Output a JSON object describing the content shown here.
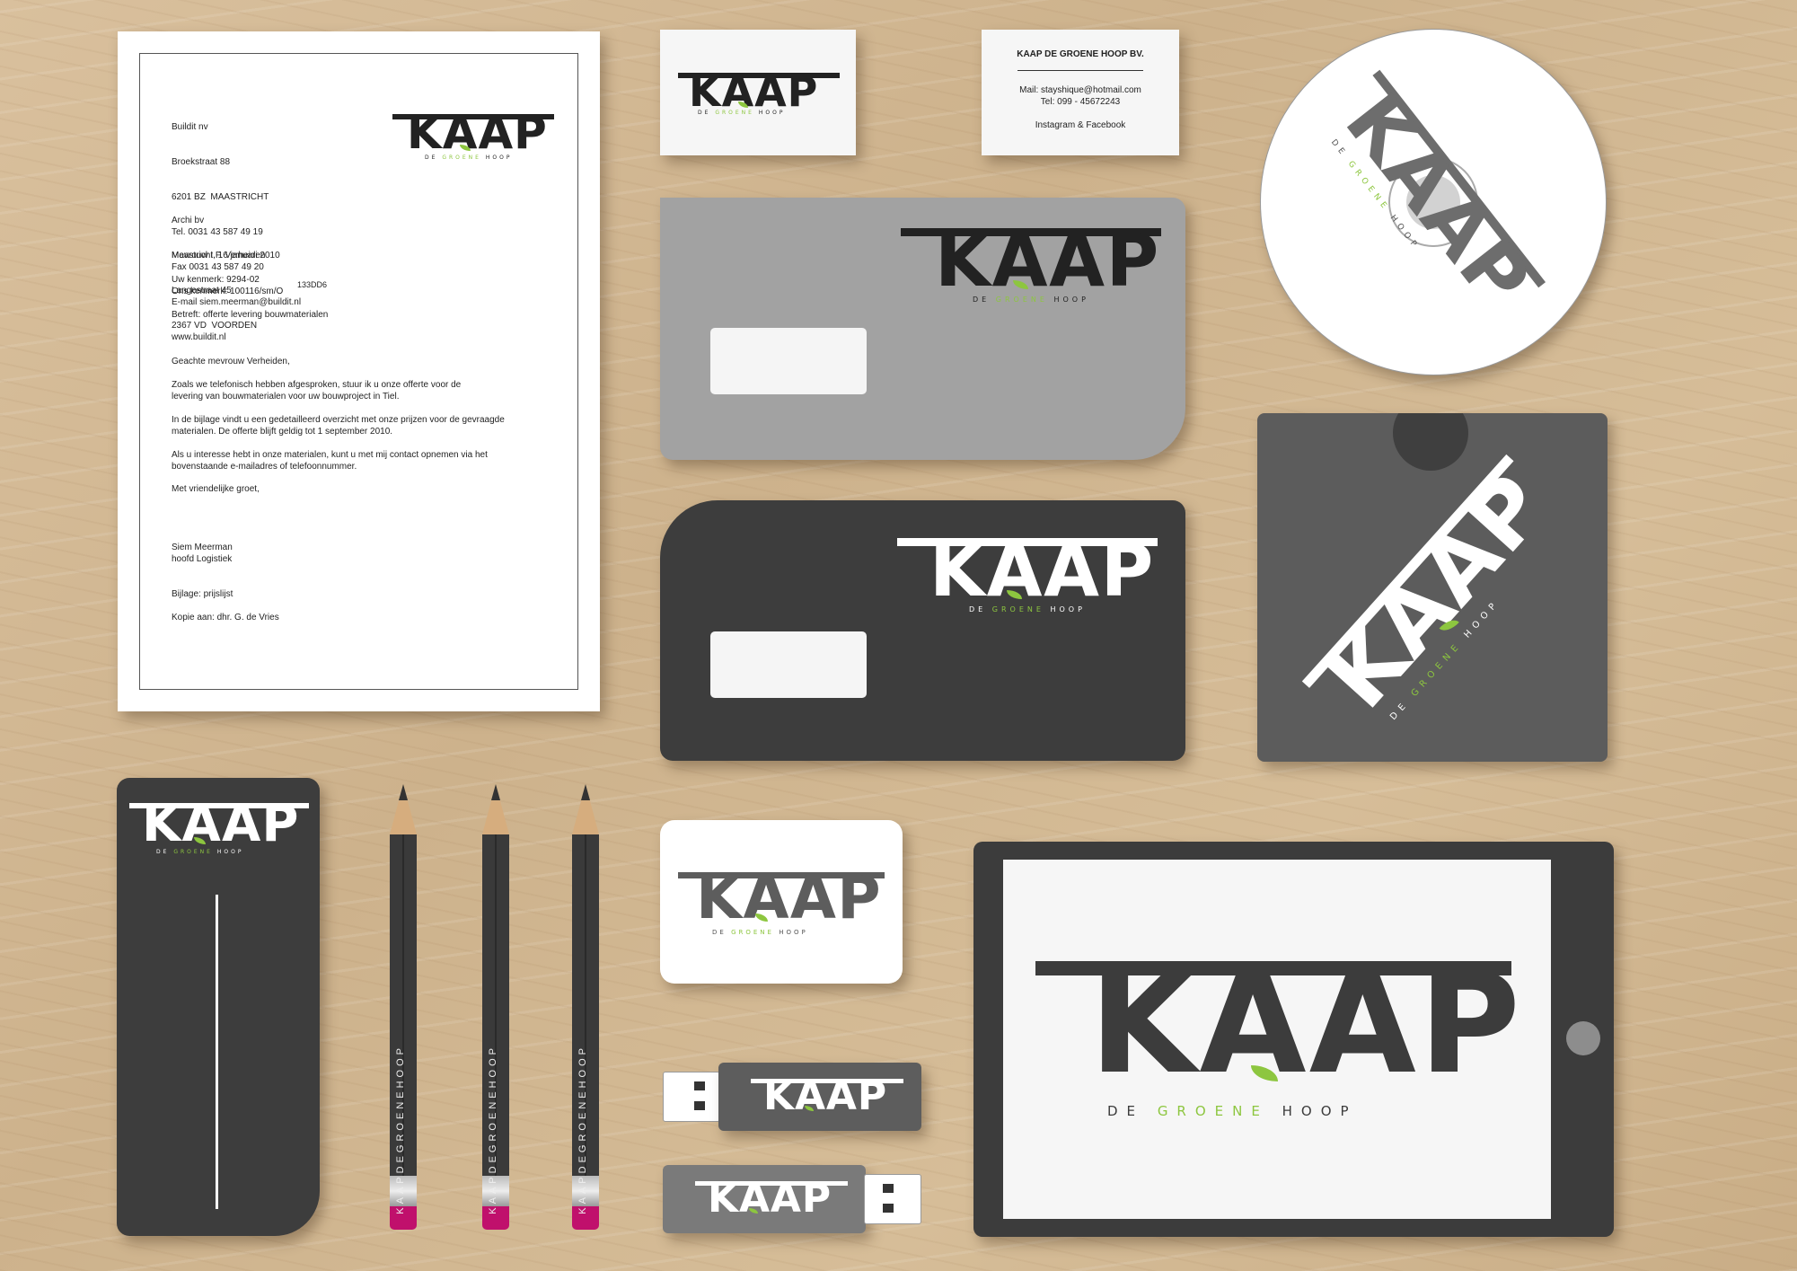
{
  "brand": {
    "logo_word": "KAAP",
    "logo_sub_de": "DE",
    "logo_sub_groene": "GROENE",
    "logo_sub_hoop": "HOOP",
    "accent_green": "#8dc63f",
    "dark_grey": "#3d3d3d",
    "mid_grey": "#a2a2a2"
  },
  "letter": {
    "sender": [
      "Buildit nv",
      "Broekstraat 88",
      "6201 BZ  MAASTRICHT",
      "Tel. 0031 43 587 49 19",
      "Fax 0031 43 587 49 20",
      "E-mail siem.meerman@buildit.nl",
      "www.buildit.nl"
    ],
    "recipient": [
      "Archi bv",
      "Mevrouw I.F. Verheiden",
      "Langestraat 45",
      "2367 VD  VOORDEN"
    ],
    "date": "Maastricht, 16 januari 2010",
    "uw_kenmerk": "Uw kenmerk: 9294-02",
    "ons_kenmerk": "Ons kenmerk: 100116/sm/O",
    "ref_code": "133DD6",
    "subject": "Betreft: offerte levering bouwmaterialen",
    "salutation": "Geachte mevrouw Verheiden,",
    "paragraphs": [
      "Zoals we telefonisch hebben afgesproken, stuur ik u onze offerte voor de\nlevering van bouwmaterialen voor uw bouwproject in Tiel.",
      "In de bijlage vindt u een gedetailleerd overzicht met onze prijzen voor de gevraagde\nmaterialen. De offerte blijft geldig tot 1 september 2010.",
      "Als u interesse hebt in onze materialen, kunt u met mij contact opnemen via het\nbovenstaande e-mailadres of telefoonnummer.",
      "Met vriendelijke groet,"
    ],
    "signer_name": "Siem Meerman",
    "signer_title": "hoofd Logistiek",
    "attachment": "Bijlage: prijslijst",
    "copy": "Kopie aan: dhr. G. de Vries"
  },
  "business_card_back": {
    "company": "KAAP DE GROENE HOOP BV.",
    "mail": "Mail: stayshique@hotmail.com",
    "tel": "Tel: 099 - 45672243",
    "social": "Instagram & Facebook"
  },
  "pencil_label": "KAAPDEGROENEHOOP"
}
